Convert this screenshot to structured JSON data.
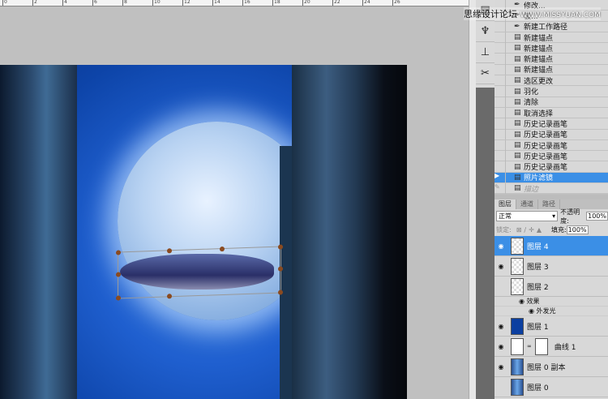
{
  "ruler": {
    "ticks": [
      "0",
      "2",
      "4",
      "6",
      "8",
      "10",
      "12",
      "14",
      "16",
      "18",
      "20",
      "22",
      "24",
      "26"
    ]
  },
  "watermark": {
    "cn": "思缘设计论坛",
    "url": "WWW.MISSYUAN.COM"
  },
  "history": {
    "items": [
      {
        "label": "修改...",
        "icon": "pen-icon"
      },
      {
        "label": "极...",
        "icon": "pen-icon"
      },
      {
        "label": "新建工作路径",
        "icon": "pen-icon"
      },
      {
        "label": "新建锚点",
        "icon": "history-state-icon"
      },
      {
        "label": "新建锚点",
        "icon": "history-state-icon"
      },
      {
        "label": "新建锚点",
        "icon": "history-state-icon"
      },
      {
        "label": "新建锚点",
        "icon": "history-state-icon"
      },
      {
        "label": "选区更改",
        "icon": "history-state-icon"
      },
      {
        "label": "羽化",
        "icon": "history-state-icon"
      },
      {
        "label": "清除",
        "icon": "history-state-icon"
      },
      {
        "label": "取消选择",
        "icon": "history-state-icon"
      },
      {
        "label": "历史记录画笔",
        "icon": "history-state-icon"
      },
      {
        "label": "历史记录画笔",
        "icon": "history-state-icon"
      },
      {
        "label": "历史记录画笔",
        "icon": "history-state-icon"
      },
      {
        "label": "历史记录画笔",
        "icon": "history-state-icon"
      },
      {
        "label": "历史记录画笔",
        "icon": "history-state-icon"
      },
      {
        "label": "照片滤镜",
        "icon": "history-state-icon",
        "selected": true
      },
      {
        "label": "描边",
        "icon": "history-state-icon",
        "dimmed": true
      }
    ]
  },
  "layers_panel": {
    "tabs": [
      "图层",
      "通道",
      "路径"
    ],
    "blend_mode": "正常",
    "opacity_label": "不透明度:",
    "opacity": "100%",
    "lock_label": "锁定:",
    "fill_label": "填充:",
    "fill": "100%",
    "layers": [
      {
        "name": "图层 4",
        "visible": true,
        "selected": true
      },
      {
        "name": "图层 3",
        "visible": true
      },
      {
        "name": "图层 2",
        "visible": false
      },
      {
        "name": "图层 1",
        "visible": true
      },
      {
        "name": "曲线 1",
        "visible": true
      },
      {
        "name": "图层 0 副本",
        "visible": true
      },
      {
        "name": "图层 0",
        "visible": false
      }
    ],
    "effects_label": "效果",
    "effect": "外发光"
  }
}
